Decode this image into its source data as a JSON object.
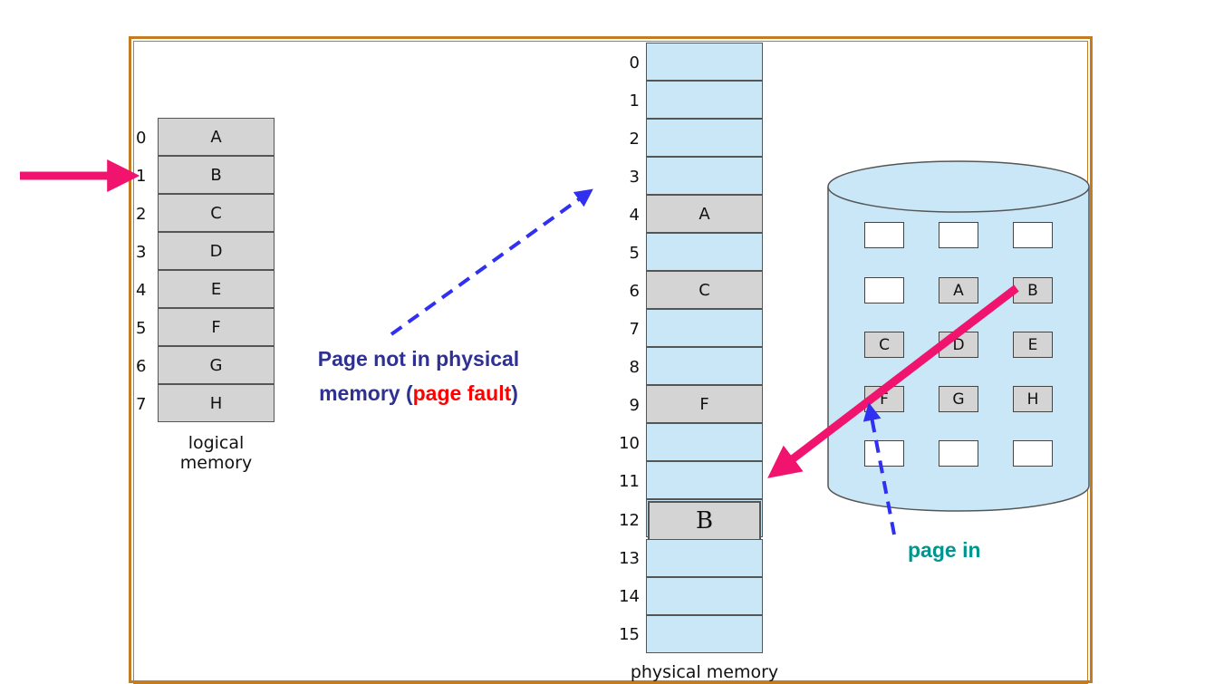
{
  "logical_memory": {
    "indices": [
      "0",
      "1",
      "2",
      "3",
      "4",
      "5",
      "6",
      "7"
    ],
    "pages": [
      "A",
      "B",
      "C",
      "D",
      "E",
      "F",
      "G",
      "H"
    ],
    "caption_line1": "logical",
    "caption_line2": "memory"
  },
  "physical_memory": {
    "indices": [
      "0",
      "1",
      "2",
      "3",
      "4",
      "5",
      "6",
      "7",
      "8",
      "9",
      "10",
      "11",
      "12",
      "13",
      "14",
      "15"
    ],
    "frames": [
      "",
      "",
      "",
      "",
      "A",
      "",
      "C",
      "",
      "",
      "F",
      "",
      "",
      "B",
      "",
      "",
      ""
    ],
    "caption": "physical memory"
  },
  "disk": {
    "slots": [
      "",
      "",
      "",
      "",
      "A",
      "B",
      "C",
      "D",
      "E",
      "F",
      "G",
      "H",
      "",
      "",
      ""
    ]
  },
  "annotations": {
    "fault_line1": "Page not in physical",
    "fault_line2_a": "memory (",
    "fault_line2_b": "page fault",
    "fault_line2_c": ")",
    "page_in": "page in"
  },
  "colors": {
    "frame_border": "#c47c20",
    "reference_arrow": "#f0146e",
    "dashed_arrow": "#3030f0",
    "fault_text": "#2e3192",
    "fault_highlight": "#ff0000",
    "page_in_text": "#00968f"
  }
}
